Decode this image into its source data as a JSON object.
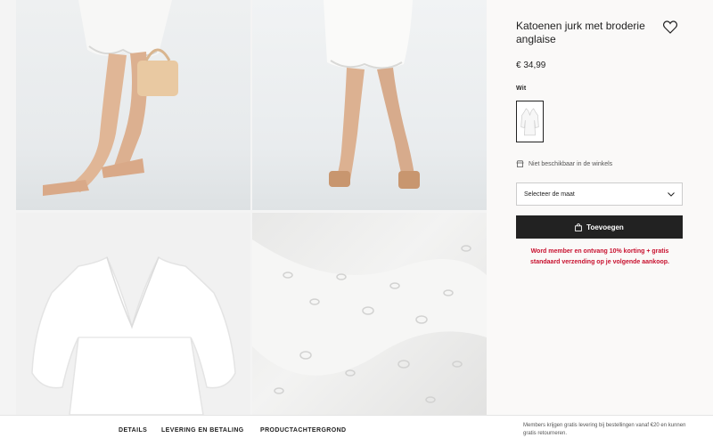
{
  "product": {
    "title": "Katoenen jurk met broderie anglaise",
    "price": "€ 34,99",
    "color_label": "Wit",
    "store_availability": "Niet beschikbaar in de winkels",
    "size_placeholder": "Selecteer de maat",
    "add_button": "Toevoegen",
    "promo": "Word member en ontvang 10% korting + gratis standaard verzending op je volgende aankoop."
  },
  "footer": {
    "tabs": [
      "DETAILS",
      "LEVERING EN BETALING",
      "PRODUCTACHTERGROND"
    ],
    "member_note": "Members krijgen gratis levering bij bestellingen vanaf €20 en kunnen gratis retourneren."
  },
  "icons": {
    "favorite": "heart-icon",
    "store": "store-icon",
    "select": "chevron-down-icon",
    "bag": "bag-icon"
  },
  "colors": {
    "accent": "#222222",
    "promo": "#c8102e",
    "background": "#faf9f8"
  }
}
